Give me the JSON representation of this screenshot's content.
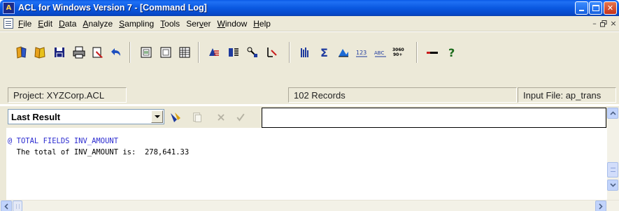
{
  "window": {
    "title": "ACL for Windows Version 7 - [Command Log]",
    "app_icon": "acl-app-icon",
    "controls": {
      "minimize": "_",
      "maximize": "□",
      "close": "✕"
    }
  },
  "menu": {
    "items": [
      {
        "label": "File",
        "access_key": "F",
        "rest": "ile"
      },
      {
        "label": "Edit",
        "access_key": "E",
        "rest": "dit"
      },
      {
        "label": "Data",
        "access_key": "D",
        "rest": "ata"
      },
      {
        "label": "Analyze",
        "access_key": "A",
        "rest": "nalyze"
      },
      {
        "label": "Sampling",
        "access_key": "S",
        "rest": "ampling"
      },
      {
        "label": "Tools",
        "access_key": "T",
        "rest": "ools"
      },
      {
        "label": "Server",
        "pre": "Ser",
        "access_key": "v",
        "rest": "er"
      },
      {
        "label": "Window",
        "access_key": "W",
        "rest": "indow"
      },
      {
        "label": "Help",
        "access_key": "H",
        "rest": "elp"
      }
    ],
    "mdi_controls": {
      "minimize": "–",
      "restore": "🗗",
      "close": "×"
    }
  },
  "toolbar": {
    "groups": [
      [
        "open-project-icon",
        "open-table-icon",
        "save-icon",
        "print-icon",
        "edit-view-icon",
        "undo-icon"
      ],
      [
        "table-layout-icon",
        "filter-icon",
        "grid-icon"
      ],
      [
        "classify-icon",
        "summarize-icon",
        "stratify-icon",
        "cross-tab-icon"
      ],
      [
        "statistics-icon",
        "total-icon",
        "profile-icon",
        "sequence-icon",
        "gaps-icon",
        "duplicates-icon"
      ],
      [
        "separator-line-icon",
        "help-icon"
      ]
    ],
    "labels": {
      "sequence": "123",
      "gaps": "ABC",
      "dup_top": "3060",
      "dup_bottom": "90+"
    }
  },
  "status": {
    "project": "Project: XYZCorp.ACL",
    "records": "102 Records",
    "input_file": "Input File: ap_trans"
  },
  "command": {
    "result_selector": "Last Result",
    "input_value": ""
  },
  "output": {
    "lines": [
      "@ TOTAL FIELDS INV_AMOUNT",
      "  The total of INV_AMOUNT is:  278,641.33"
    ]
  },
  "colors": {
    "titlebar": "#0a58e0",
    "chrome": "#ece9d8",
    "command_text": "#2b2bd0",
    "close_button": "#c5321a"
  }
}
